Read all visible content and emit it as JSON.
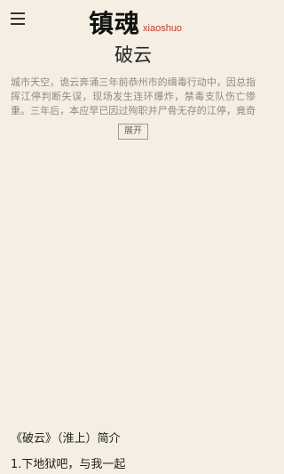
{
  "header": {
    "menu_icon": "hamburger-menu-icon",
    "logo_cn": "镇魂",
    "logo_en": "xiaoshuo"
  },
  "book": {
    "title": "破云",
    "description": "城市天空，诡云奔涌三年前恭州市的缉毒行动中，因总指挥江停判断失误，现场发生连环爆炸，禁毒支队伤亡惨重。三年后，本应早已因过殉职并尸骨无存的江停，竟奇迹般从植物…",
    "expand_label": "展开"
  },
  "section": {
    "intro_label": "《破云》（淮上）简介"
  },
  "chapters": [
    {
      "label": "1.下地狱吧，与我一起"
    }
  ],
  "colors": {
    "background": "#f5efe3",
    "logo_accent": "#c0392b",
    "description_text": "#8d8a83"
  }
}
